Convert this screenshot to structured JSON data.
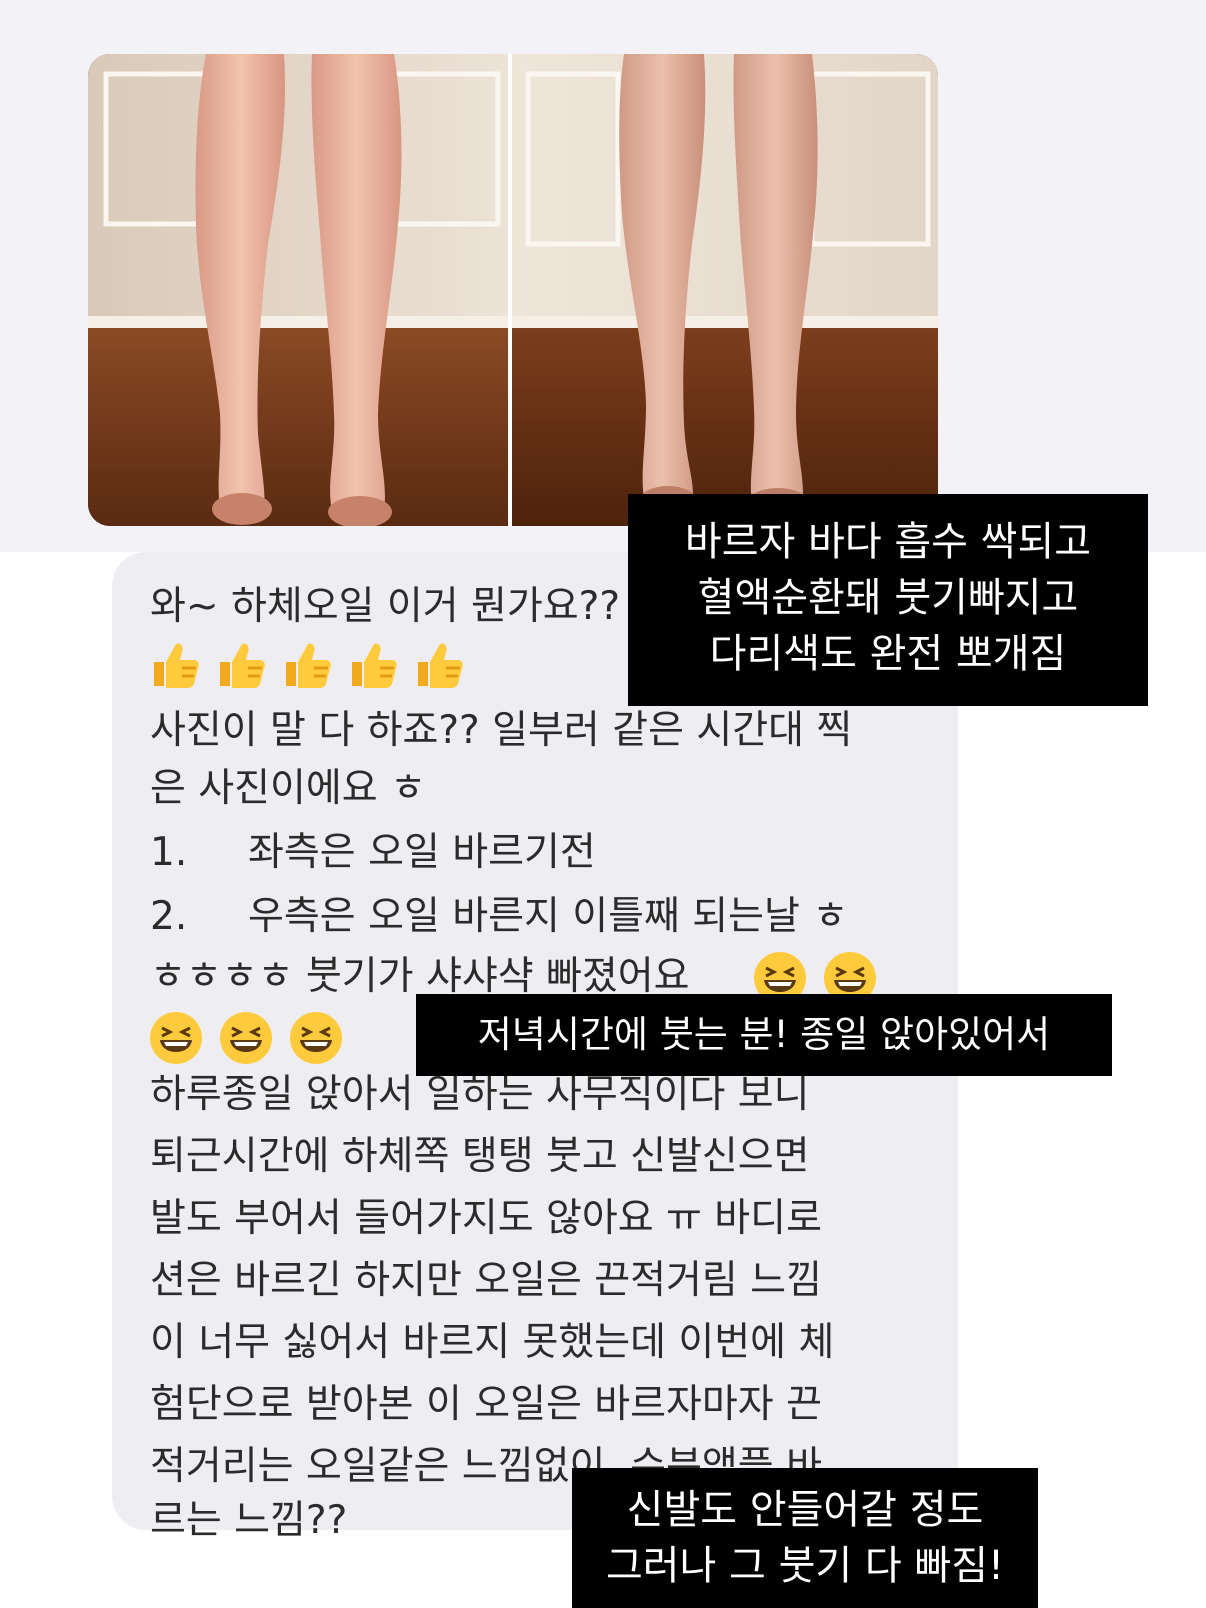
{
  "message": {
    "line1": "와~ 하체오일 이거 뭔가요??",
    "line_photo_a": "사진이 말 다 하죠?? 일부러 같은 시간대 찍",
    "line_photo_b": "은 사진이에요 ㅎ",
    "item1_num": "1.",
    "item1_text": "좌측은 오일 바르기전",
    "item2_num": "2.",
    "item2_text": "우측은 오일 바른지 이틀째 되는날 ㅎ",
    "line_laugh_a": "ㅎㅎㅎㅎ 붓기가 샤샤샥 빠졌어요",
    "body": [
      "하루종일 앉아서 일하는 사무직이다 보니",
      "퇴근시간에 하체쪽 탱탱 붓고 신발신으면",
      "발도 부어서 들어가지도 않아요 ㅠ 바디로",
      "션은 바르긴 하지만 오일은 끈적거림 느낌",
      "이 너무 싫어서 바르지 못했는데 이번에 체",
      "험단으로 받아본 이 오일은 바르자마자 끈",
      "적거리는 오일같은 느낌없이, 수분앰플 바",
      "르는 느낌??"
    ],
    "thumbs_icon": "thumbs-up-emoji",
    "laugh_icon": "grinning-squinting-emoji"
  },
  "captions": {
    "caption1": [
      "바르자 바다 흡수 싹되고",
      "혈액순환돼 붓기빠지고",
      "다리색도 완전 뽀개짐"
    ],
    "caption2": "저녁시간에 붓는 분! 종일 앉아있어서",
    "caption3": [
      "신발도 안들어갈 정도",
      "그러나 그 붓기 다 빠짐!"
    ]
  },
  "colors": {
    "bubble": "#eeeef2",
    "caption_bg": "#000000",
    "caption_text": "#ffffff",
    "message_text": "#2b2b2b"
  }
}
